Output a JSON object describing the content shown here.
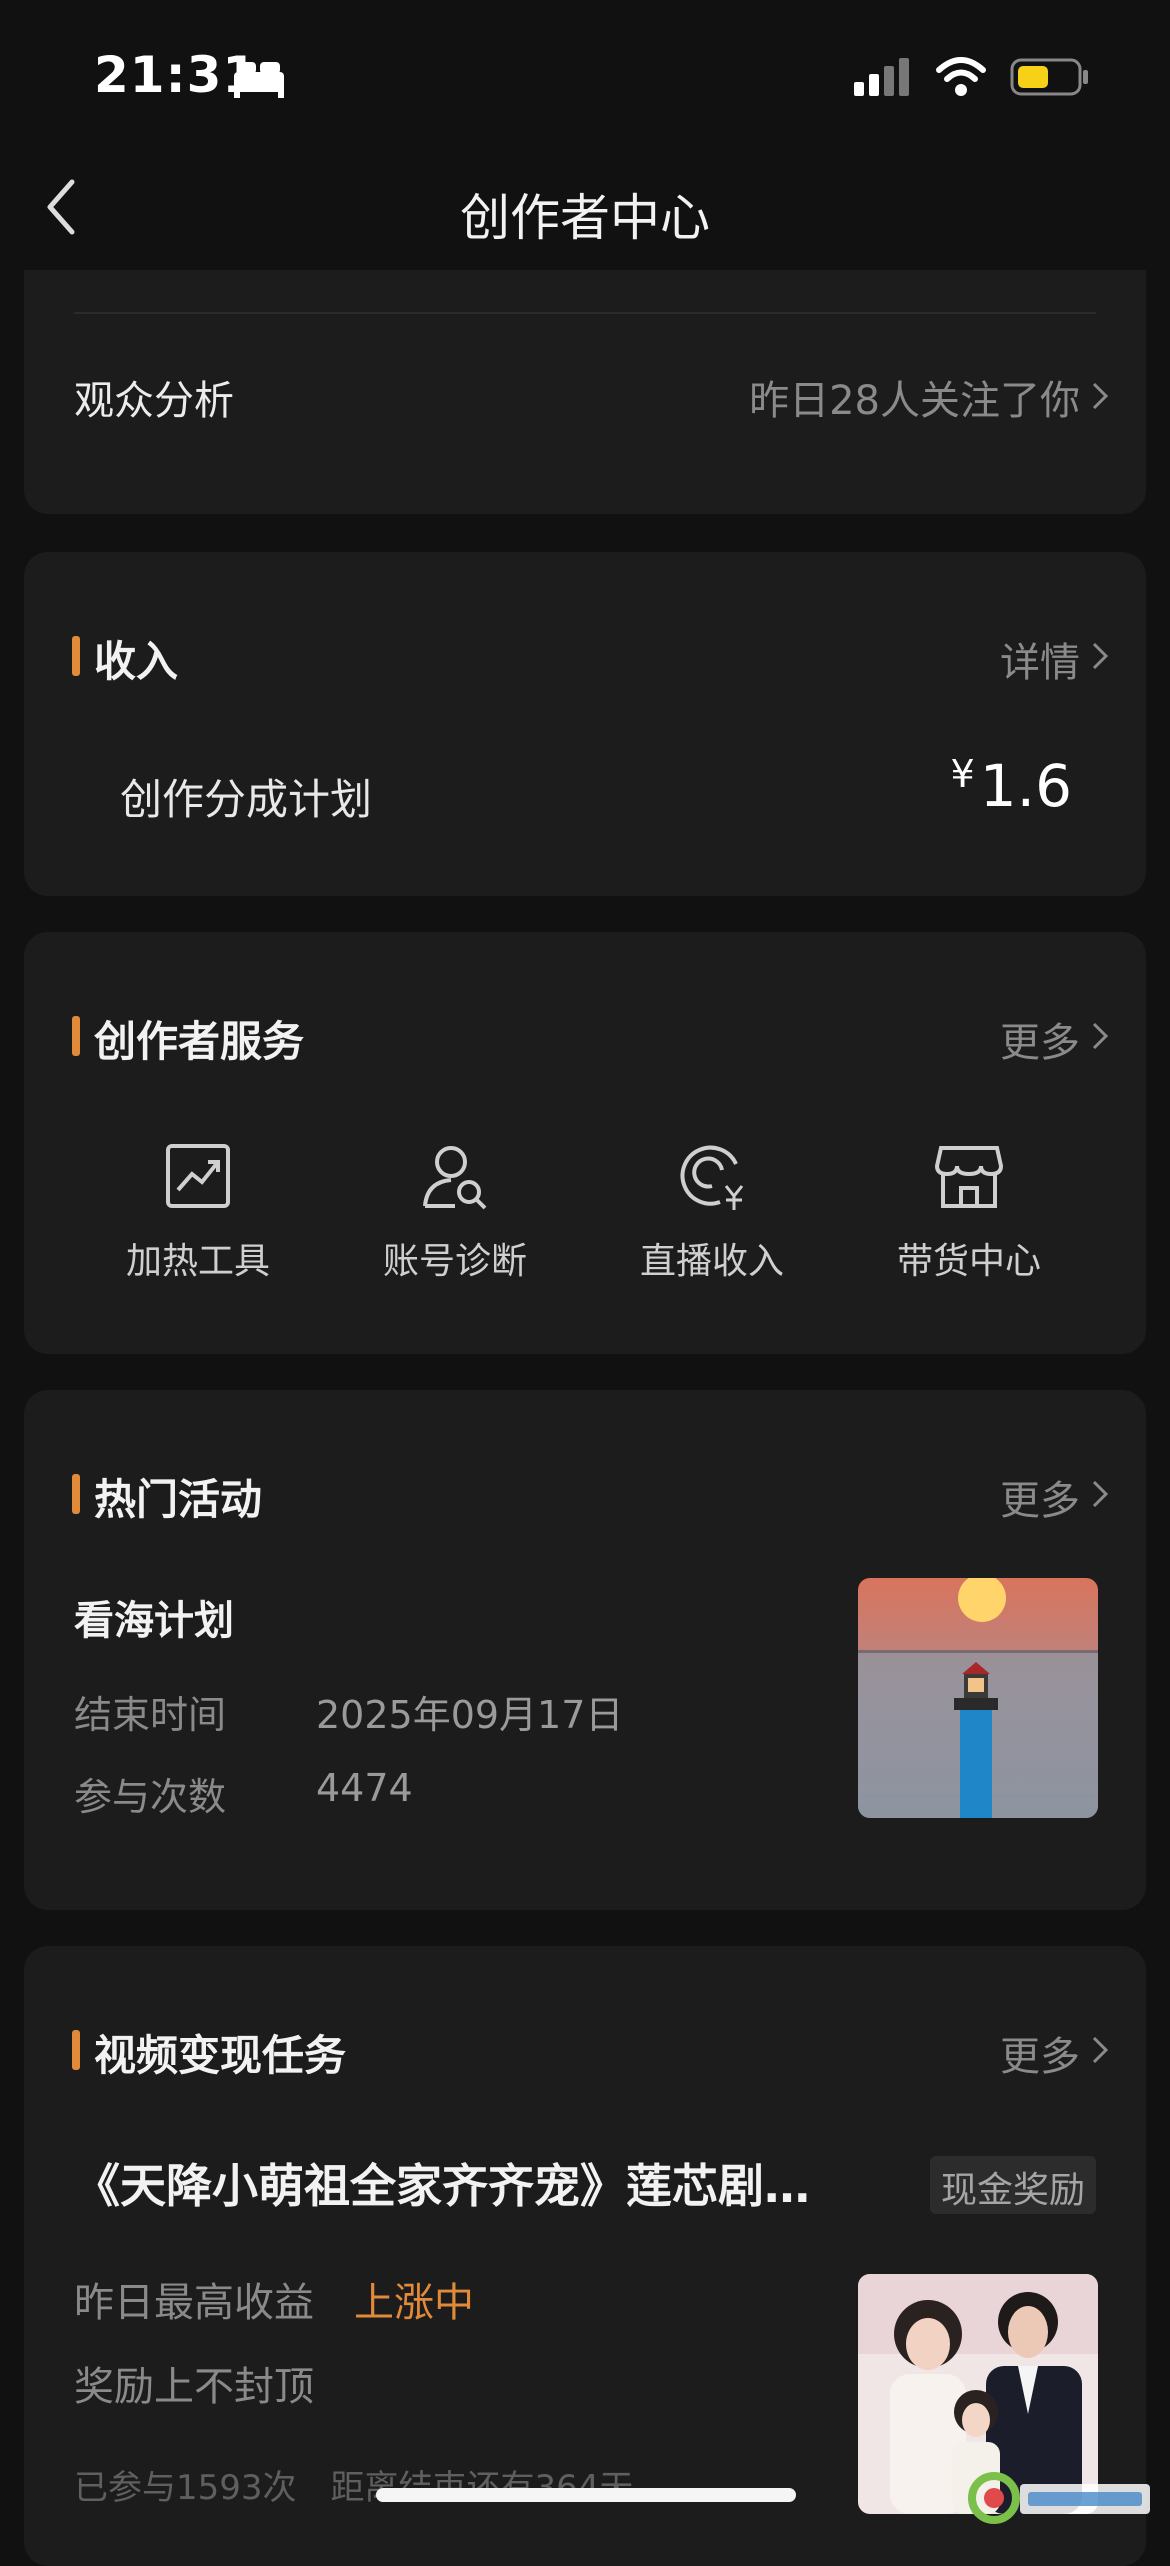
{
  "status": {
    "time": "21:31"
  },
  "nav": {
    "title": "创作者中心"
  },
  "audience": {
    "label": "观众分析",
    "value": "昨日28人关注了你"
  },
  "income": {
    "title": "收入",
    "more": "详情",
    "plan_label": "创作分成计划",
    "amount_symbol": "¥",
    "amount": "1.6"
  },
  "services": {
    "title": "创作者服务",
    "more": "更多",
    "items": [
      {
        "label": "加热工具",
        "icon": "chart-up-icon"
      },
      {
        "label": "账号诊断",
        "icon": "user-search-icon"
      },
      {
        "label": "直播收入",
        "icon": "live-income-icon"
      },
      {
        "label": "带货中心",
        "icon": "store-icon"
      }
    ]
  },
  "activities": {
    "title": "热门活动",
    "more": "更多",
    "name": "看海计划",
    "end_label": "结束时间",
    "end_value": "2025年09月17日",
    "count_label": "参与次数",
    "count_value": "4474"
  },
  "tasks": {
    "title": "视频变现任务",
    "more": "更多",
    "task_title": "《天降小萌祖全家齐齐宠》莲芯剧…",
    "badge": "现金奖励",
    "income_label": "昨日最高收益",
    "income_trend": "上涨中",
    "note": "奖励上不封顶",
    "footer": "已参与1593次　距离结束还有364天"
  },
  "colors": {
    "accent": "#e08a3a",
    "card": "#1c1c1c",
    "background": "#111111"
  }
}
